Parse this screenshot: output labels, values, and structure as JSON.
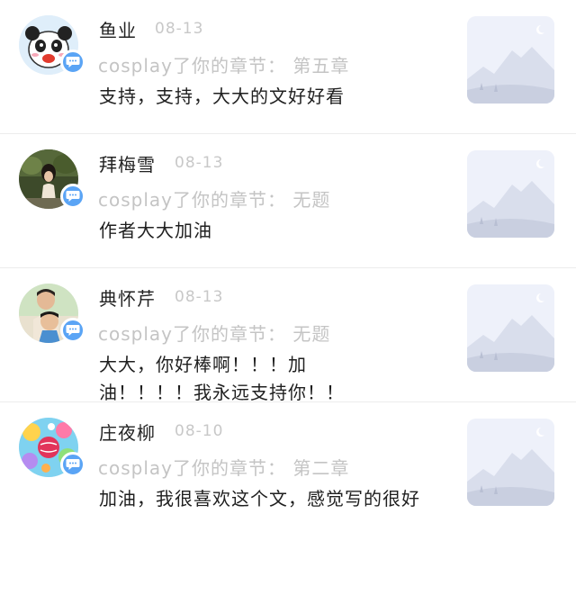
{
  "comments": [
    {
      "name": "鱼业",
      "date": "08-13",
      "reference": "cosplay了你的章节： 第五章",
      "content": "支持，支持，大大的文好好看",
      "avatar_icon": "panda-avatar-icon"
    },
    {
      "name": "拜梅雪",
      "date": "08-13",
      "reference": "cosplay了你的章节： 无题",
      "content": "作者大大加油",
      "avatar_icon": "photo-avatar-icon"
    },
    {
      "name": "典怀芹",
      "date": "08-13",
      "reference": "cosplay了你的章节： 无题",
      "content": "大大，你好棒啊！！！加油！！！！我永远支持你！！",
      "avatar_icon": "photo-avatar-icon"
    },
    {
      "name": "庄夜柳",
      "date": "08-10",
      "reference": "cosplay了你的章节： 第二章",
      "content": "加油，我很喜欢这个文，感觉写的很好",
      "avatar_icon": "colorful-avatar-icon"
    }
  ],
  "colors": {
    "badge": "#5aa4f5",
    "muted_text": "#c4c4c4",
    "thumbnail_bg": "#eef1fa"
  }
}
